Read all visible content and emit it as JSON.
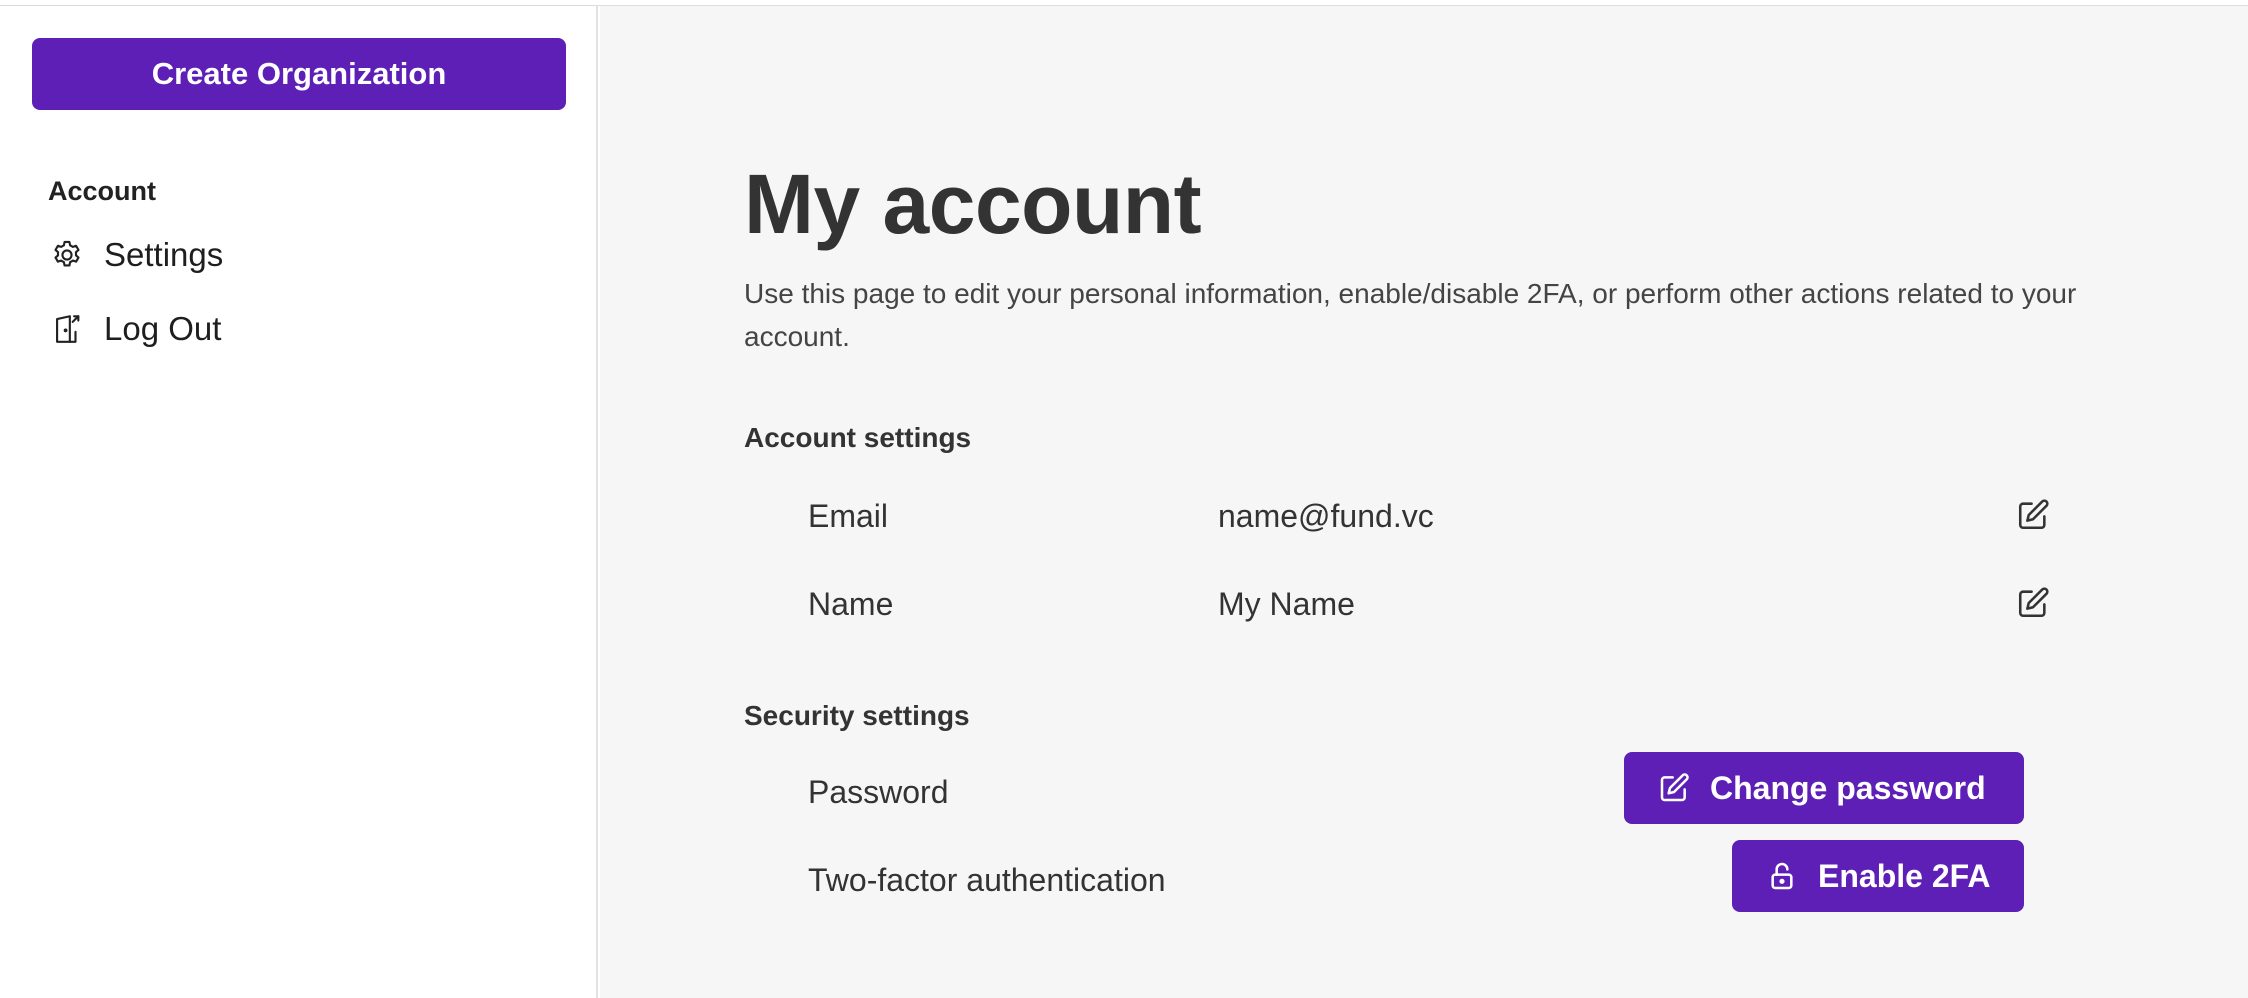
{
  "sidebar": {
    "create_button_label": "Create Organization",
    "section_title": "Account",
    "items": [
      {
        "label": "Settings",
        "icon": "gear-icon"
      },
      {
        "label": "Log Out",
        "icon": "logout-door-icon"
      }
    ]
  },
  "main": {
    "title": "My account",
    "description": "Use this page to edit your personal information, enable/disable 2FA, or perform other actions related to your account.",
    "account_settings": {
      "title": "Account settings",
      "rows": [
        {
          "label": "Email",
          "value": "name@fund.vc",
          "icon": "edit-icon"
        },
        {
          "label": "Name",
          "value": "My Name",
          "icon": "edit-icon"
        }
      ]
    },
    "security_settings": {
      "title": "Security settings",
      "rows": [
        {
          "label": "Password",
          "button_label": "Change password",
          "icon": "edit-icon"
        },
        {
          "label": "Two-factor authentication",
          "button_label": "Enable 2FA",
          "icon": "lock-icon"
        }
      ]
    }
  },
  "colors": {
    "accent": "#5e1fb7",
    "main_background": "#f6f6f6",
    "text": "#333333"
  }
}
